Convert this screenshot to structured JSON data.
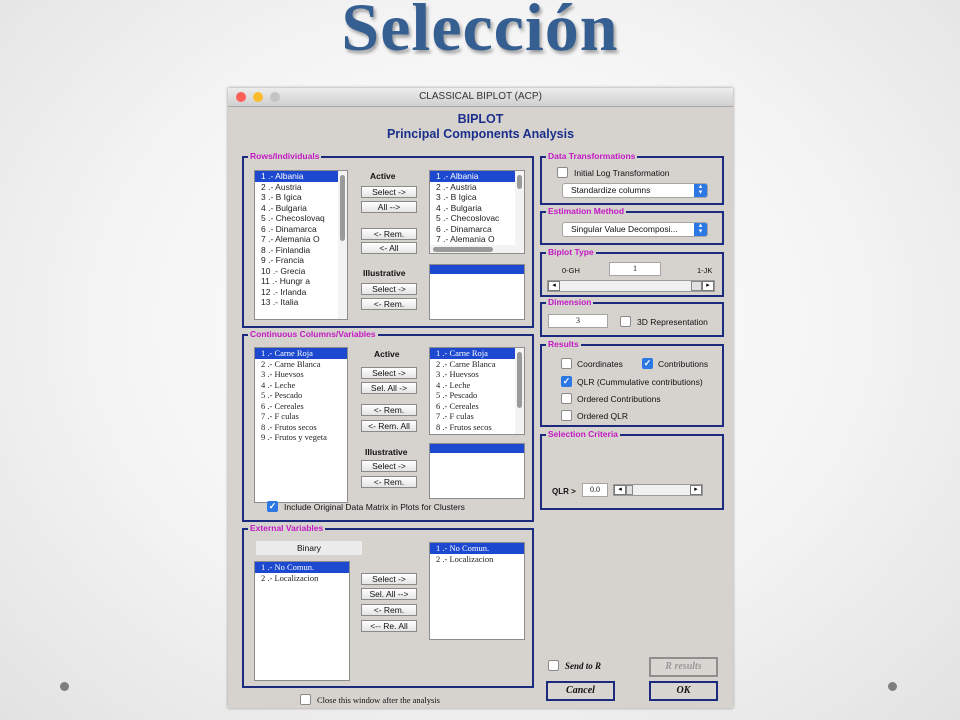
{
  "slide": {
    "title": "Selección"
  },
  "window": {
    "title": "CLASSICAL BIPLOT (ACP)",
    "heading1": "BIPLOT",
    "heading2": "Principal Components Analysis"
  },
  "rows": {
    "title": "Rows/Individuals",
    "source_items": [
      "1 .- Albania",
      "2 .- Austria",
      "3 .- B Igica",
      "4 .- Bulgaria",
      "5 .- Checoslovaq",
      "6 .- Dinamarca",
      "7 .- Alemania O",
      "8 .- Finlandia",
      "9 .- Francia",
      "10 .- Grecia",
      "11 .- Hungr a",
      "12 .- Irlanda",
      "13 .- Italia"
    ],
    "active_label": "Active",
    "select_btn": "Select ->",
    "all_btn": "All -->",
    "rem_btn": "<- Rem.",
    "rem_all_btn": "<- All",
    "illustrative_label": "Illustrative",
    "ill_select_btn": "Select ->",
    "ill_rem_btn": "<- Rem.",
    "active_items": [
      "1 .- Albania",
      "2 .- Austria",
      "3 .- B Igica",
      "4 .- Bulgaria",
      "5 .- Checoslovac",
      "6 .- Dinamarca",
      "7 .- Alemania O"
    ]
  },
  "columns": {
    "title": "Continuous Columns/Variables",
    "source_items": [
      "1 .- Carne Roja",
      "2 .- Carne Blanca",
      "3 .- Huevsos",
      "4 .- Leche",
      "5 .- Pescado",
      "6 .- Cereales",
      "7 .- F culas",
      "8 .- Frutos secos",
      "9 .- Frutos y vegeta"
    ],
    "active_label": "Active",
    "select_btn": "Select ->",
    "sel_all_btn": "Sel. All ->",
    "rem_btn": "<- Rem.",
    "rem_all_btn": "<- Rem. All",
    "illustrative_label": "Illustrative",
    "ill_select_btn": "Select ->",
    "ill_rem_btn": "<- Rem.",
    "active_items": [
      "1 .- Carne Roja",
      "2 .- Carne Blanca",
      "3 .- Huevsos",
      "4 .- Leche",
      "5 .- Pescado",
      "6 .- Cereales",
      "7 .- F culas",
      "8 .- Frutos secos"
    ],
    "include_label": "Include Original Data Matrix in Plots for Clusters",
    "include_checked": true
  },
  "external": {
    "title": "External Variables",
    "binary_label": "Binary",
    "source_items": [
      "1 .- No Comun.",
      "2 .- Localizacion"
    ],
    "select_btn": "Select ->",
    "sel_all_btn": "Sel. All -->",
    "rem_btn": "<- Rem.",
    "re_all_btn": "<-- Re. All",
    "selected_items": [
      "1 .- No Comun.",
      "2 .- Localizacion"
    ]
  },
  "transform": {
    "title": "Data Transformations",
    "log_label": "Initial Log Transformation",
    "log_checked": false,
    "method_value": "Standardize columns"
  },
  "estimation": {
    "title": "Estimation Method",
    "value": "Singular Value Decomposi..."
  },
  "biplot_type": {
    "title": "Biplot Type",
    "left_label": "0-GH",
    "right_label": "1-JK",
    "value": "1"
  },
  "dimension": {
    "title": "Dimension",
    "value": "3",
    "rep3d_label": "3D Representation",
    "rep3d_checked": false
  },
  "results": {
    "title": "Results",
    "coordinates": "Coordinates",
    "contributions": "Contributions",
    "qlr": "QLR (Cummulative contributions)",
    "ordered_contributions": "Ordered Contributions",
    "ordered_qlr": "Ordered QLR",
    "coordinates_checked": false,
    "contributions_checked": true,
    "qlr_checked": true,
    "ordered_contributions_checked": false,
    "ordered_qlr_checked": false
  },
  "selection": {
    "title": "Selection Criteria",
    "qlr_label": "QLR >",
    "qlr_value": "0.0"
  },
  "footer": {
    "send_to_r": "Send to R",
    "r_results": "R results",
    "cancel": "Cancel",
    "ok": "OK",
    "close_label": "Close this window after the analysis"
  },
  "colors": {
    "title": "#365f91",
    "panel_border": "#1c2a7e",
    "panel_title": "#c418c4",
    "selection": "#1c49d0"
  }
}
